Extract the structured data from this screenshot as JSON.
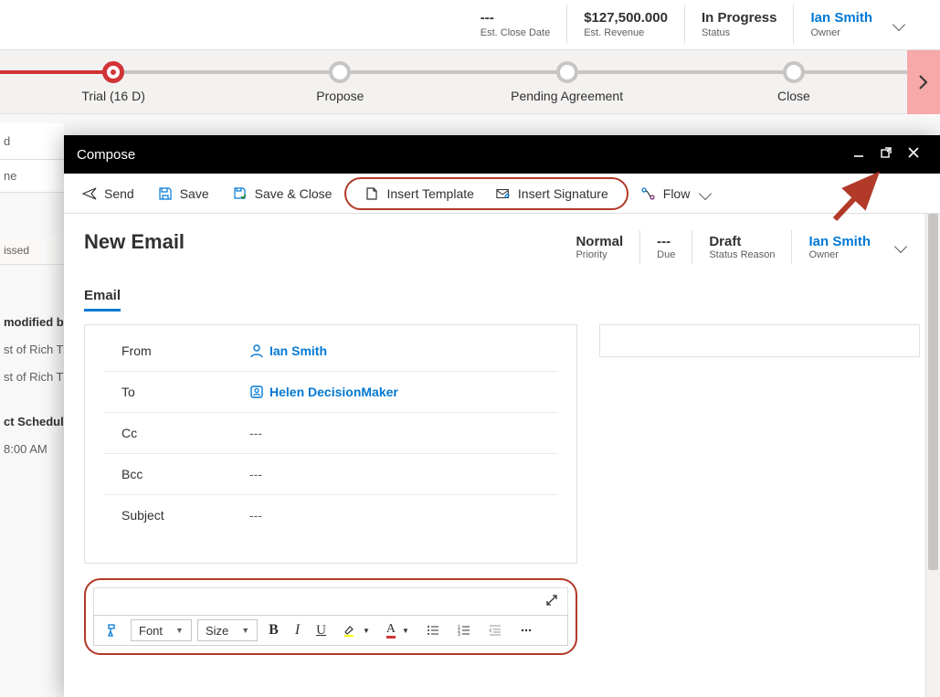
{
  "bg": {
    "infoCells": [
      {
        "value": "---",
        "label": "Est. Close Date"
      },
      {
        "value": "$127,500.000",
        "label": "Est. Revenue"
      },
      {
        "value": "In Progress",
        "label": "Status"
      },
      {
        "value": "Ian Smith",
        "label": "Owner",
        "blue": true
      }
    ],
    "bpf": [
      {
        "name": "Trial  (16 D)",
        "active": true
      },
      {
        "name": "Propose"
      },
      {
        "name": "Pending Agreement"
      },
      {
        "name": "Close"
      }
    ],
    "left": {
      "tab1": "d",
      "section1": "ne",
      "dismissedRow": "issed",
      "modifiedBy": "modified by",
      "line1": "st of Rich T",
      "line2": "st of Rich T",
      "schedule": "ct Schedule",
      "time": " 8:00 AM"
    }
  },
  "compose": {
    "title": "Compose",
    "commands": {
      "send": "Send",
      "save": "Save",
      "saveClose": "Save & Close",
      "insertTemplate": "Insert Template",
      "insertSignature": "Insert Signature",
      "flow": "Flow"
    },
    "formTitle": "New Email",
    "summary": [
      {
        "value": "Normal",
        "label": "Priority"
      },
      {
        "value": "---",
        "label": "Due"
      },
      {
        "value": "Draft",
        "label": "Status Reason"
      },
      {
        "value": "Ian Smith",
        "label": "Owner",
        "blue": true
      }
    ],
    "activeTab": "Email",
    "fields": {
      "from": {
        "label": "From",
        "value": "Ian Smith"
      },
      "to": {
        "label": "To",
        "value": "Helen DecisionMaker"
      },
      "cc": {
        "label": "Cc",
        "value": "---"
      },
      "bcc": {
        "label": "Bcc",
        "value": "---"
      },
      "subject": {
        "label": "Subject",
        "value": "---"
      }
    },
    "editor": {
      "fontLabel": "Font",
      "sizeLabel": "Size"
    }
  }
}
